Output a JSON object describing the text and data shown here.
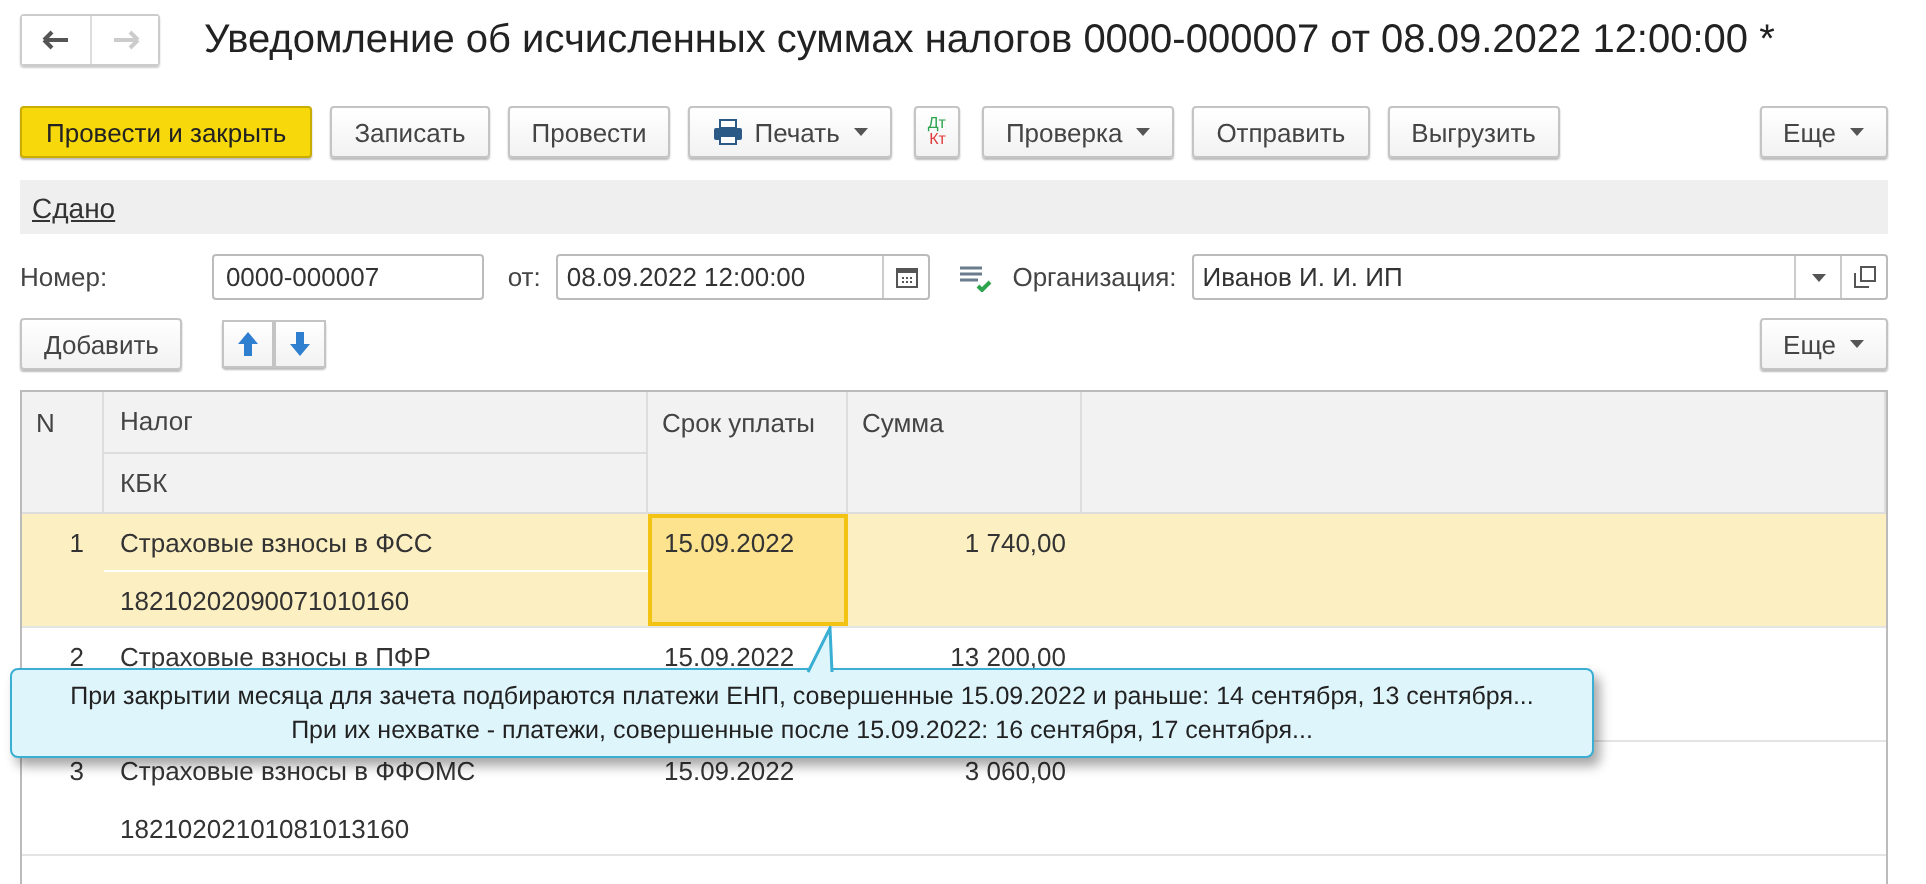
{
  "window": {
    "title": "Уведомление об исчисленных суммах налогов 0000-000007 от 08.09.2022 12:00:00 *"
  },
  "toolbar": [
    {
      "kind": "primary",
      "label": "Провести и закрыть"
    },
    {
      "kind": "plain",
      "label": "Записать"
    },
    {
      "kind": "plain",
      "label": "Провести"
    },
    {
      "kind": "print",
      "label": "Печать"
    },
    {
      "kind": "dtkt",
      "label": "Дт",
      "label2": "Кт"
    },
    {
      "kind": "dropdown",
      "label": "Проверка"
    },
    {
      "kind": "plain",
      "label": "Отправить"
    },
    {
      "kind": "plain",
      "label": "Выгрузить"
    },
    {
      "kind": "more",
      "label": "Еще"
    }
  ],
  "status_link": "Сдано",
  "fields": {
    "number_label": "Номер:",
    "number": "0000-000007",
    "date_label": "от:",
    "date": "08.09.2022 12:00:00",
    "org_label": "Организация:",
    "org": "Иванов И. И. ИП"
  },
  "table_toolbar": {
    "add": "Добавить",
    "more": "Еще"
  },
  "table": {
    "columns": {
      "n": "N",
      "tax": "Налог",
      "kbk": "КБК",
      "due": "Срок уплаты",
      "sum": "Сумма"
    },
    "rows": [
      {
        "n": "1",
        "tax": "Страховые взносы в ФСС",
        "kbk": "18210202090071010160",
        "due": "15.09.2022",
        "sum": "1 740,00",
        "selected": true
      },
      {
        "n": "2",
        "tax": "Страховые взносы в ПФР",
        "due": "15.09.2022",
        "sum": "13 200,00",
        "selected": false
      },
      {
        "n": "3",
        "tax": "Страховые взносы в ФФОМС",
        "kbk": "18210202101081013160",
        "due": "15.09.2022",
        "sum": "3 060,00",
        "selected": false
      }
    ]
  },
  "tooltip": {
    "lines": [
      "При закрытии месяца для зачета подбираются платежи ЕНП, совершенные 15.09.2022 и раньше: 14 сентября, 13 сентября...",
      "При их нехватке - платежи, совершенные после 15.09.2022: 16 сентября, 17 сентября..."
    ]
  }
}
